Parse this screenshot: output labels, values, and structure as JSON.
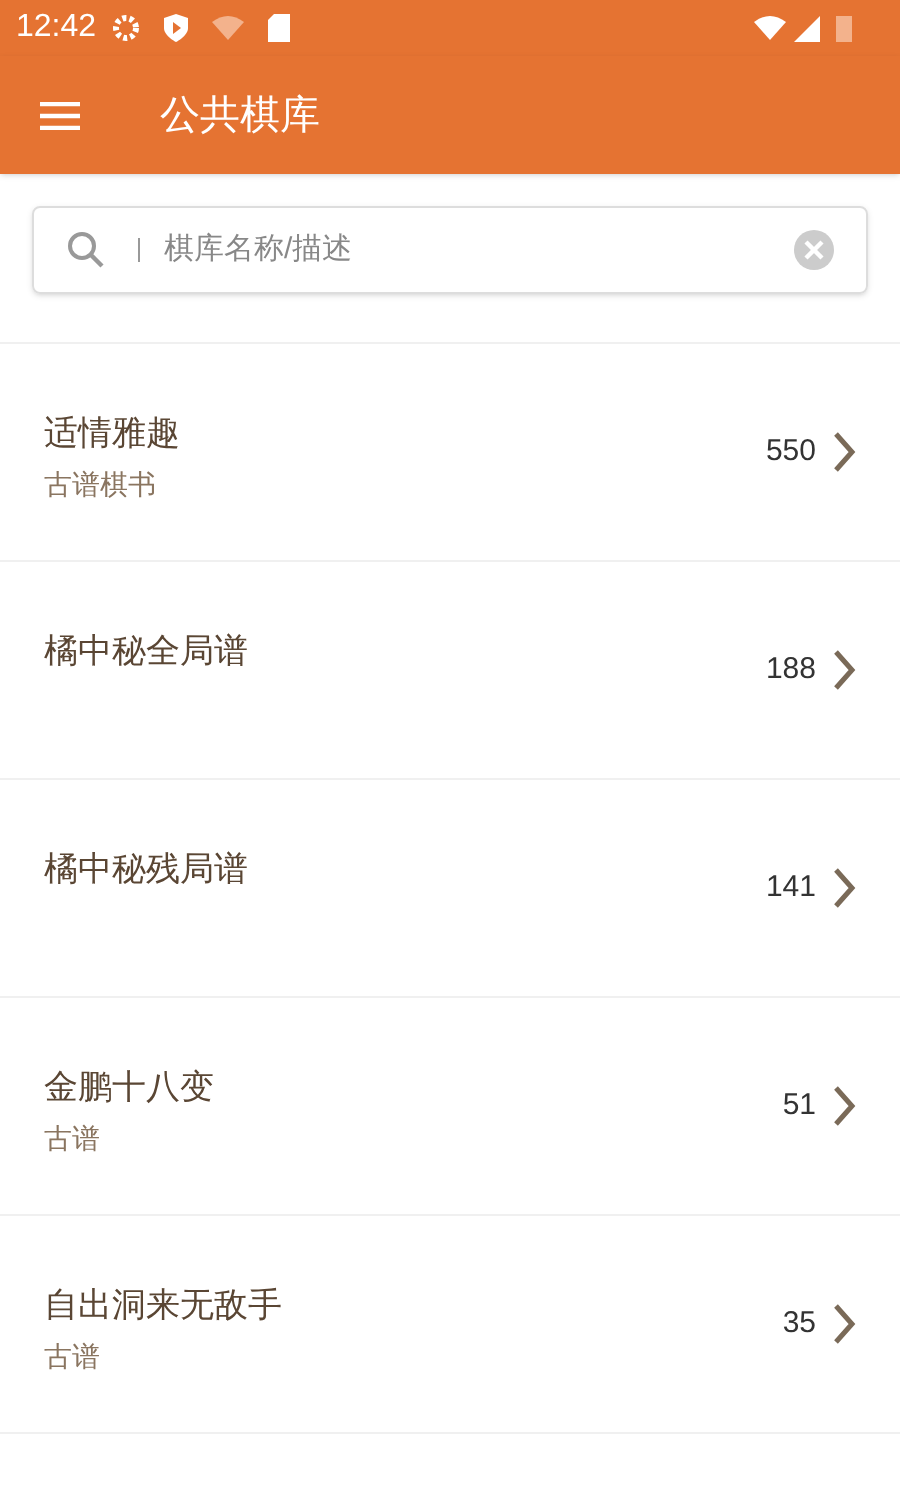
{
  "status_bar": {
    "time": "12:42"
  },
  "app_bar": {
    "title": "公共棋库"
  },
  "search": {
    "placeholder": "棋库名称/描述"
  },
  "libraries": [
    {
      "title": "适情雅趣",
      "subtitle": "古谱棋书",
      "count": "550"
    },
    {
      "title": "橘中秘全局谱",
      "count": "188"
    },
    {
      "title": "橘中秘残局谱",
      "count": "141"
    },
    {
      "title": "金鹏十八变",
      "subtitle": "古谱",
      "count": "51"
    },
    {
      "title": "自出洞来无敌手",
      "subtitle": "古谱",
      "count": "35"
    }
  ]
}
